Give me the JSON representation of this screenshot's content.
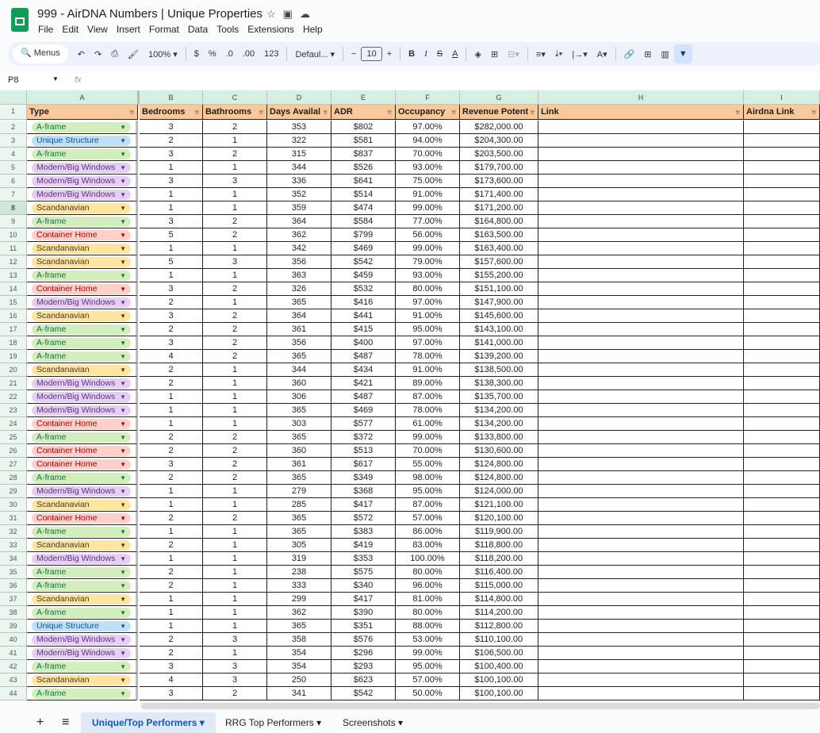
{
  "title": "999 - AirDNA Numbers | Unique Properties",
  "menu": [
    "File",
    "Edit",
    "View",
    "Insert",
    "Format",
    "Data",
    "Tools",
    "Extensions",
    "Help"
  ],
  "toolbar": {
    "search": "Menus",
    "zoom": "100%",
    "currency": "$",
    "percent": "%",
    "dec_dec": ".0",
    "inc_dec": ".00",
    "format": "123",
    "font": "Defaul...",
    "font_size": "10",
    "bold": "B",
    "italic": "I"
  },
  "name_box": "P8",
  "fx": "fx",
  "columns": [
    "A",
    "B",
    "C",
    "D",
    "E",
    "F",
    "G",
    "H",
    "I"
  ],
  "headers": [
    "Type",
    "Bedrooms",
    "Bathrooms",
    "Days Availal",
    "ADR",
    "Occupancy",
    "Revenue Potent",
    "Link",
    "Airdna Link"
  ],
  "type_colors": {
    "A-frame": [
      "#d4edbc",
      "#11734b"
    ],
    "Unique Structure": [
      "#bfe1f6",
      "#0a53a8"
    ],
    "Modern/Big Windows": [
      "#e6cff2",
      "#5a3286"
    ],
    "Scandanavian": [
      "#ffe5a0",
      "#473821"
    ],
    "Container Home": [
      "#ffcfc9",
      "#b10202"
    ]
  },
  "rows": [
    [
      "A-frame",
      "3",
      "2",
      "353",
      "$802",
      "97.00%",
      "$282,000.00"
    ],
    [
      "Unique Structure",
      "2",
      "1",
      "322",
      "$581",
      "94.00%",
      "$204,300.00"
    ],
    [
      "A-frame",
      "3",
      "2",
      "315",
      "$837",
      "70.00%",
      "$203,500.00"
    ],
    [
      "Modern/Big Windows",
      "1",
      "1",
      "344",
      "$526",
      "93.00%",
      "$179,700.00"
    ],
    [
      "Modern/Big Windows",
      "3",
      "3",
      "336",
      "$641",
      "75.00%",
      "$173,600.00"
    ],
    [
      "Modern/Big Windows",
      "1",
      "1",
      "352",
      "$514",
      "91.00%",
      "$171,400.00"
    ],
    [
      "Scandanavian",
      "1",
      "1",
      "359",
      "$474",
      "99.00%",
      "$171,200.00"
    ],
    [
      "A-frame",
      "3",
      "2",
      "364",
      "$584",
      "77.00%",
      "$164,800.00"
    ],
    [
      "Container Home",
      "5",
      "2",
      "362",
      "$799",
      "56.00%",
      "$163,500.00"
    ],
    [
      "Scandanavian",
      "1",
      "1",
      "342",
      "$469",
      "99.00%",
      "$163,400.00"
    ],
    [
      "Scandanavian",
      "5",
      "3",
      "356",
      "$542",
      "79.00%",
      "$157,600.00"
    ],
    [
      "A-frame",
      "1",
      "1",
      "363",
      "$459",
      "93.00%",
      "$155,200.00"
    ],
    [
      "Container Home",
      "3",
      "2",
      "326",
      "$532",
      "80.00%",
      "$151,100.00"
    ],
    [
      "Modern/Big Windows",
      "2",
      "1",
      "365",
      "$416",
      "97.00%",
      "$147,900.00"
    ],
    [
      "Scandanavian",
      "3",
      "2",
      "364",
      "$441",
      "91.00%",
      "$145,600.00"
    ],
    [
      "A-frame",
      "2",
      "2",
      "361",
      "$415",
      "95.00%",
      "$143,100.00"
    ],
    [
      "A-frame",
      "3",
      "2",
      "356",
      "$400",
      "97.00%",
      "$141,000.00"
    ],
    [
      "A-frame",
      "4",
      "2",
      "365",
      "$487",
      "78.00%",
      "$139,200.00"
    ],
    [
      "Scandanavian",
      "2",
      "1",
      "344",
      "$434",
      "91.00%",
      "$138,500.00"
    ],
    [
      "Modern/Big Windows",
      "2",
      "1",
      "360",
      "$421",
      "89.00%",
      "$138,300.00"
    ],
    [
      "Modern/Big Windows",
      "1",
      "1",
      "306",
      "$487",
      "87.00%",
      "$135,700.00"
    ],
    [
      "Modern/Big Windows",
      "1",
      "1",
      "365",
      "$469",
      "78.00%",
      "$134,200.00"
    ],
    [
      "Container Home",
      "1",
      "1",
      "303",
      "$577",
      "61.00%",
      "$134,200.00"
    ],
    [
      "A-frame",
      "2",
      "2",
      "365",
      "$372",
      "99.00%",
      "$133,800.00"
    ],
    [
      "Container Home",
      "2",
      "2",
      "360",
      "$513",
      "70.00%",
      "$130,600.00"
    ],
    [
      "Container Home",
      "3",
      "2",
      "361",
      "$617",
      "55.00%",
      "$124,800.00"
    ],
    [
      "A-frame",
      "2",
      "2",
      "365",
      "$349",
      "98.00%",
      "$124,800.00"
    ],
    [
      "Modern/Big Windows",
      "1",
      "1",
      "279",
      "$368",
      "95.00%",
      "$124,000.00"
    ],
    [
      "Scandanavian",
      "1",
      "1",
      "285",
      "$417",
      "87.00%",
      "$121,100.00"
    ],
    [
      "Container Home",
      "2",
      "2",
      "365",
      "$572",
      "57.00%",
      "$120,100.00"
    ],
    [
      "A-frame",
      "1",
      "1",
      "365",
      "$383",
      "86.00%",
      "$119,900.00"
    ],
    [
      "Scandanavian",
      "2",
      "1",
      "305",
      "$419",
      "83.00%",
      "$118,800.00"
    ],
    [
      "Modern/Big Windows",
      "1",
      "1",
      "319",
      "$353",
      "100.00%",
      "$118,200.00"
    ],
    [
      "A-frame",
      "2",
      "1",
      "238",
      "$575",
      "80.00%",
      "$116,400.00"
    ],
    [
      "A-frame",
      "2",
      "1",
      "333",
      "$340",
      "96.00%",
      "$115,000.00"
    ],
    [
      "Scandanavian",
      "1",
      "1",
      "299",
      "$417",
      "81.00%",
      "$114,800.00"
    ],
    [
      "A-frame",
      "1",
      "1",
      "362",
      "$390",
      "80.00%",
      "$114,200.00"
    ],
    [
      "Unique Structure",
      "1",
      "1",
      "365",
      "$351",
      "88.00%",
      "$112,800.00"
    ],
    [
      "Modern/Big Windows",
      "2",
      "3",
      "358",
      "$576",
      "53.00%",
      "$110,100.00"
    ],
    [
      "Modern/Big Windows",
      "2",
      "1",
      "354",
      "$296",
      "99.00%",
      "$106,500.00"
    ],
    [
      "A-frame",
      "3",
      "3",
      "354",
      "$293",
      "95.00%",
      "$100,400.00"
    ],
    [
      "Scandanavian",
      "4",
      "3",
      "250",
      "$623",
      "57.00%",
      "$100,100.00"
    ],
    [
      "A-frame",
      "3",
      "2",
      "341",
      "$542",
      "50.00%",
      "$100,100.00"
    ]
  ],
  "sheets": [
    "Unique/Top Performers",
    "RRG Top Performers",
    "Screenshots"
  ]
}
